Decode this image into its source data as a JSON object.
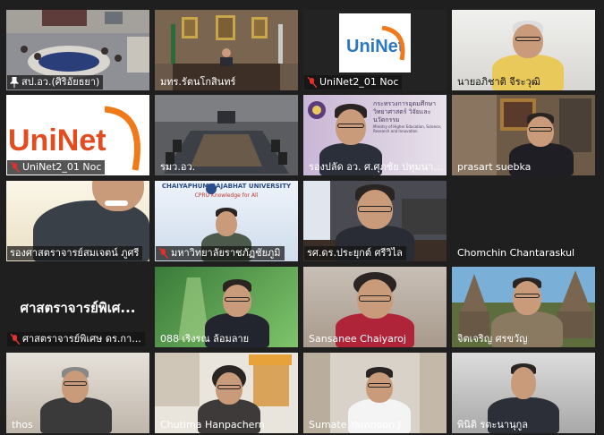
{
  "tiles": [
    {
      "id": "t1",
      "label": "สป.อว.(ศิริอัยธยา)",
      "icon": "pin"
    },
    {
      "id": "t2",
      "label": "มทร.รัตนโกสินทร์",
      "icon": "none"
    },
    {
      "id": "t3",
      "label": "UniNet2_01 Noc",
      "icon": "mic-muted",
      "logo": "UniNet"
    },
    {
      "id": "t4",
      "label": "นายอภิชาติ จีระวุฒิ",
      "icon": "none"
    },
    {
      "id": "t5",
      "label": "UniNet2_01 Noc",
      "icon": "mic-muted",
      "logo": "UniNet"
    },
    {
      "id": "t6",
      "label": "รมว.อว.",
      "icon": "none"
    },
    {
      "id": "t7",
      "label": "รองปลัด อว. ศ.ศุภชัย ปทุมนา...",
      "icon": "none"
    },
    {
      "id": "t8",
      "label": "prasart suebka",
      "icon": "none"
    },
    {
      "id": "t9",
      "label": "รองศาสตราจารย์สมเจตน์ ภูศรี",
      "icon": "none"
    },
    {
      "id": "t10",
      "label": "มหาวิทยาลัยราชภัฏชัยภูมิ",
      "icon": "mic-muted",
      "banner_top": "CHAIYAPHUM RAJABHAT UNIVERSITY",
      "banner_sub": "CPRU Knowledge for All"
    },
    {
      "id": "t11",
      "label": "รศ.ดร.ประยุกต์ ศรีวิไล",
      "icon": "none"
    },
    {
      "id": "t12",
      "label": "Chomchin Chantaraskul",
      "icon": "none"
    },
    {
      "id": "t13",
      "label": "ศาสตราจารย์พิเศษ ดร.กา...",
      "icon": "mic-muted",
      "center_text": "ศาสตราจารย์พิเศ..."
    },
    {
      "id": "t14",
      "label": "088 เริงรณ ล้อมลาย",
      "icon": "none"
    },
    {
      "id": "t15",
      "label": "Sansanee Chaiyaroj",
      "icon": "none"
    },
    {
      "id": "t16",
      "label": "จิตเจริญ ศรขวัญ",
      "icon": "none"
    },
    {
      "id": "t17",
      "label": "thos",
      "icon": "none"
    },
    {
      "id": "t18",
      "label": "Chutima Hanpachern",
      "icon": "none"
    },
    {
      "id": "t19",
      "label": "Sumate Yamnoon J",
      "icon": "none"
    },
    {
      "id": "t20",
      "label": "พินิติ รตะนานุกูล",
      "icon": "none"
    }
  ],
  "banner7": {
    "line1": "กระทรวงการอุดมศึกษา",
    "line2": "วิทยาศาสตร์ วิจัยและนวัตกรรม",
    "line3": "Ministry of Higher Education, Science, Research and Innovation"
  },
  "colors": {
    "background": "#1f1f1f",
    "active_speaker": "#e8e23a",
    "muted_mic": "#e0312b",
    "uninet_orange": "#f07a1a"
  },
  "active_tile": "t9"
}
